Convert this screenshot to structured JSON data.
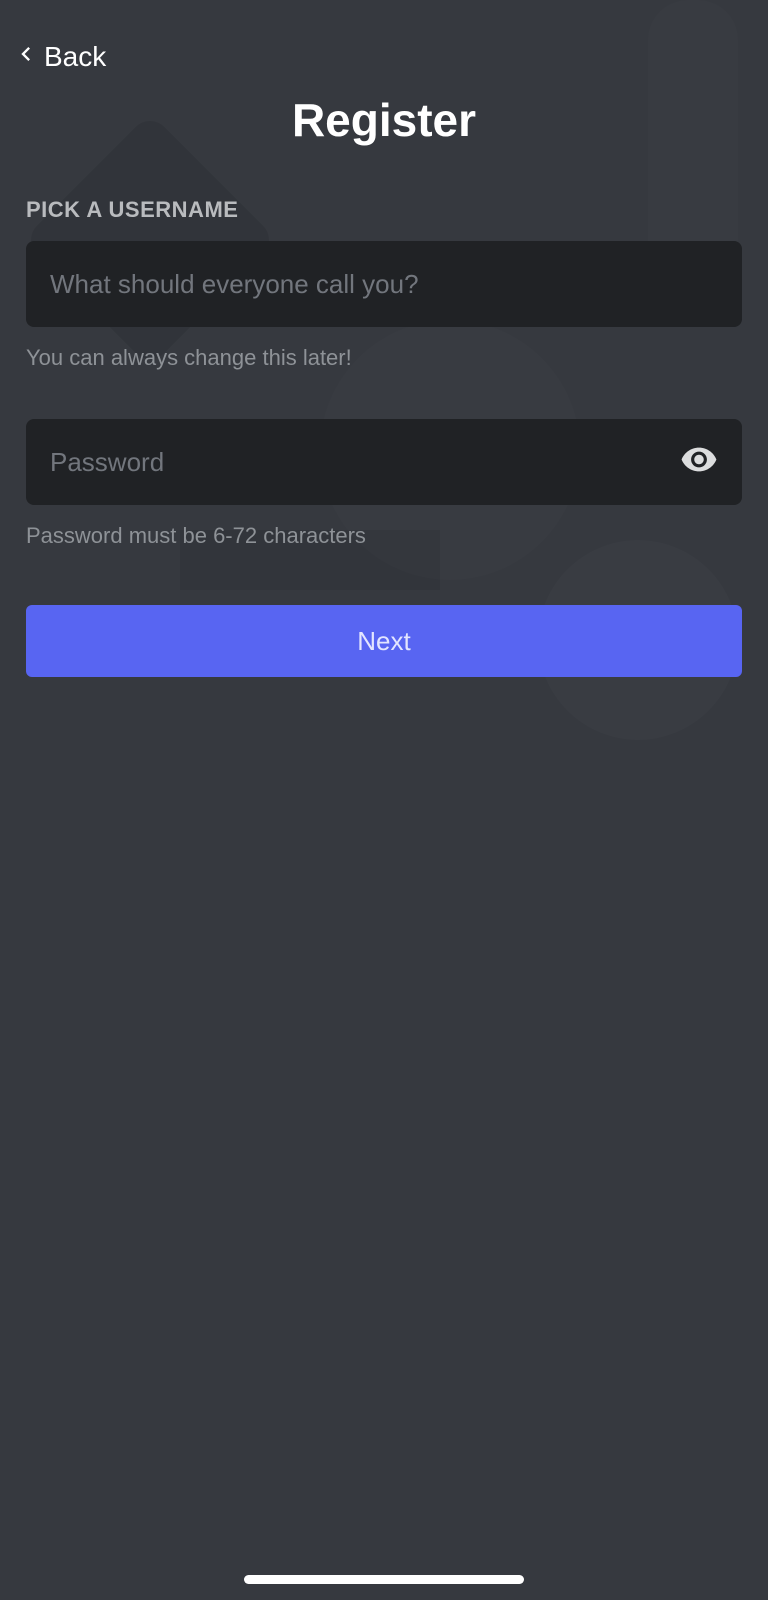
{
  "nav": {
    "back_label": "Back"
  },
  "page": {
    "title": "Register"
  },
  "username": {
    "label": "PICK A USERNAME",
    "placeholder": "What should everyone call you?",
    "hint": "You can always change this later!"
  },
  "password": {
    "placeholder": "Password",
    "hint": "Password must be 6-72 characters"
  },
  "actions": {
    "next_label": "Next"
  }
}
